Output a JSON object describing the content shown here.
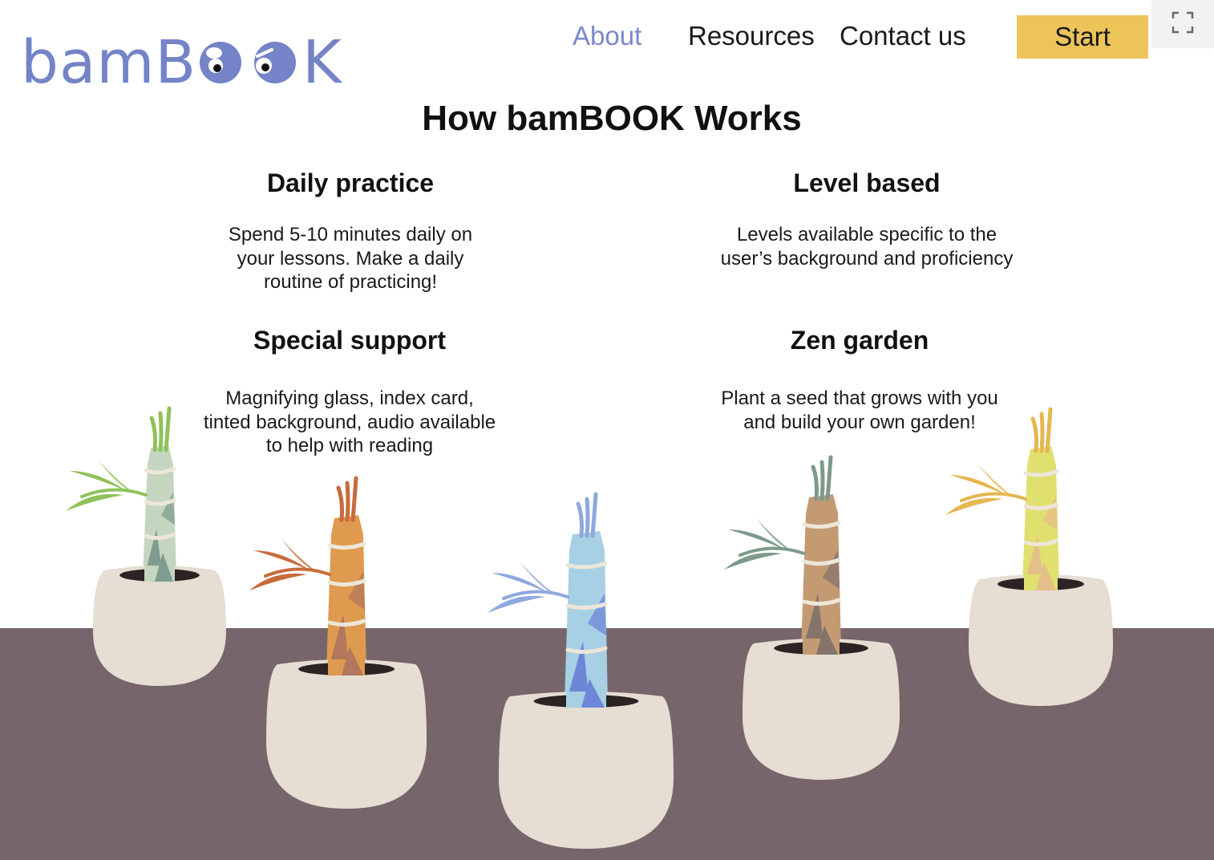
{
  "logo": {
    "text_before": "bamB",
    "text_after": "K",
    "color": "#7583c8",
    "eyes_icon": "googly-eyes-icon"
  },
  "nav": {
    "about": "About",
    "resources": "Resources",
    "contact": "Contact us",
    "start": "Start",
    "active_color": "#7b88cc",
    "start_color": "#ecc459"
  },
  "fullscreen_icon": "fullscreen-icon",
  "page": {
    "title": "How bamBOOK Works"
  },
  "features": [
    {
      "title": "Daily practice",
      "lines": [
        "Spend 5-10 minutes daily on",
        "your lessons. Make a daily",
        "routine of practicing!"
      ]
    },
    {
      "title": "Level based",
      "lines": [
        "Levels available specific to the",
        "user’s background and proficiency"
      ]
    },
    {
      "title": "Special support",
      "lines": [
        "Magnifying glass, index card,",
        "tinted background, audio available",
        "to help with reading"
      ]
    },
    {
      "title": "Zen garden",
      "lines": [
        "Plant a seed that grows with you",
        "and build your own garden!"
      ]
    }
  ],
  "scene": {
    "floor_color": "#76666b",
    "pot_color": "#e6ddd3",
    "plants": [
      {
        "name": "green-bamboo-plant",
        "color": "#c5d6c0",
        "dark": "#7f9c90",
        "leaf": "#8fc25a"
      },
      {
        "name": "orange-bamboo-plant",
        "color": "#de9a4e",
        "dark": "#b2775c",
        "leaf": "#c86a3c"
      },
      {
        "name": "blue-bamboo-plant",
        "color": "#a7d0e4",
        "dark": "#6e86d8",
        "leaf": "#8fa8de"
      },
      {
        "name": "brown-bamboo-plant",
        "color": "#c49a73",
        "dark": "#85746b",
        "leaf": "#7d9a8a"
      },
      {
        "name": "yellow-bamboo-plant",
        "color": "#dfe06e",
        "dark": "#e6c08a",
        "leaf": "#e6b64f"
      }
    ]
  }
}
